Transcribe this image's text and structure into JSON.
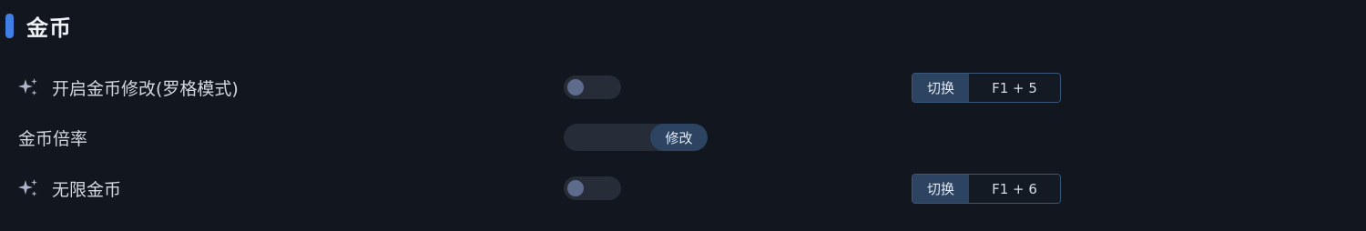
{
  "section": {
    "title": "金币"
  },
  "rows": [
    {
      "label": "开启金币修改(罗格模式)",
      "icon": "sparkle-icon",
      "toggle_on": false,
      "hotkey_switch": "切换",
      "hotkey_keys": "F1 + 5"
    },
    {
      "label": "金币倍率",
      "input_value": "",
      "button_label": "修改"
    },
    {
      "label": "无限金币",
      "icon": "sparkle-icon",
      "toggle_on": false,
      "hotkey_switch": "切换",
      "hotkey_keys": "F1 + 6"
    }
  ],
  "colors": {
    "background": "#12161e",
    "accent": "#3f7fe6",
    "control_bg": "#272d38",
    "button_bg": "#2c4462",
    "knob": "#5e6b8c",
    "border": "#3a5678"
  }
}
